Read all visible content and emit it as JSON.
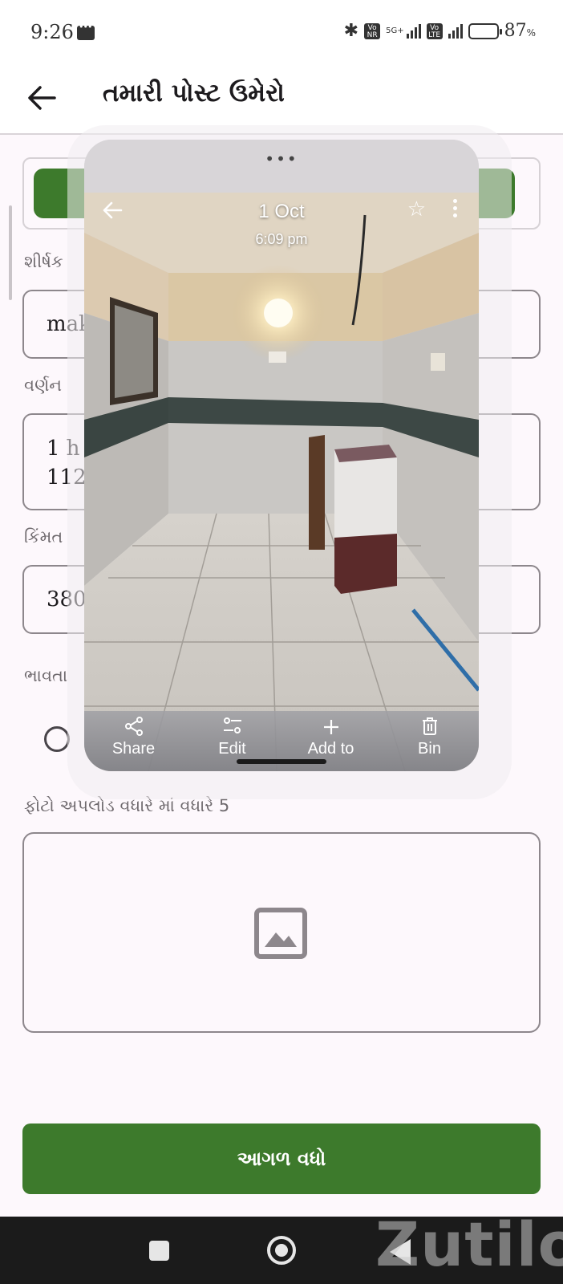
{
  "status_bar": {
    "time": "9:26",
    "net_badge_1": "Vo NR",
    "net_type": "5G+",
    "net_badge_2": "Vo LTE",
    "battery_percent": "87",
    "battery_unit": "%",
    "battery_level": 0.87
  },
  "app_bar": {
    "title": "તમારી પોસ્ટ ઉમેરો"
  },
  "form": {
    "title_label": "શીર્ષક",
    "title_value": "mak",
    "description_label": "વર્ણન",
    "description_line1": "1 h",
    "description_line2": "112",
    "price_label": "કિંમત",
    "price_value": "380",
    "negotiable_label": "ભાવતા",
    "photo_upload_label": "ફોટો અપલોડ વધારે માં વધારે 5",
    "submit_label": "આગળ વધો"
  },
  "photo_viewer": {
    "date": "1 Oct",
    "time": "6:09 pm",
    "actions": {
      "share": "Share",
      "edit": "Edit",
      "add_to": "Add to",
      "bin": "Bin"
    }
  },
  "watermark": "Zutilo",
  "colors": {
    "primary_green": "#3d7a2c",
    "background": "#fdf8fc",
    "nav_bar": "#1b1b1b"
  }
}
